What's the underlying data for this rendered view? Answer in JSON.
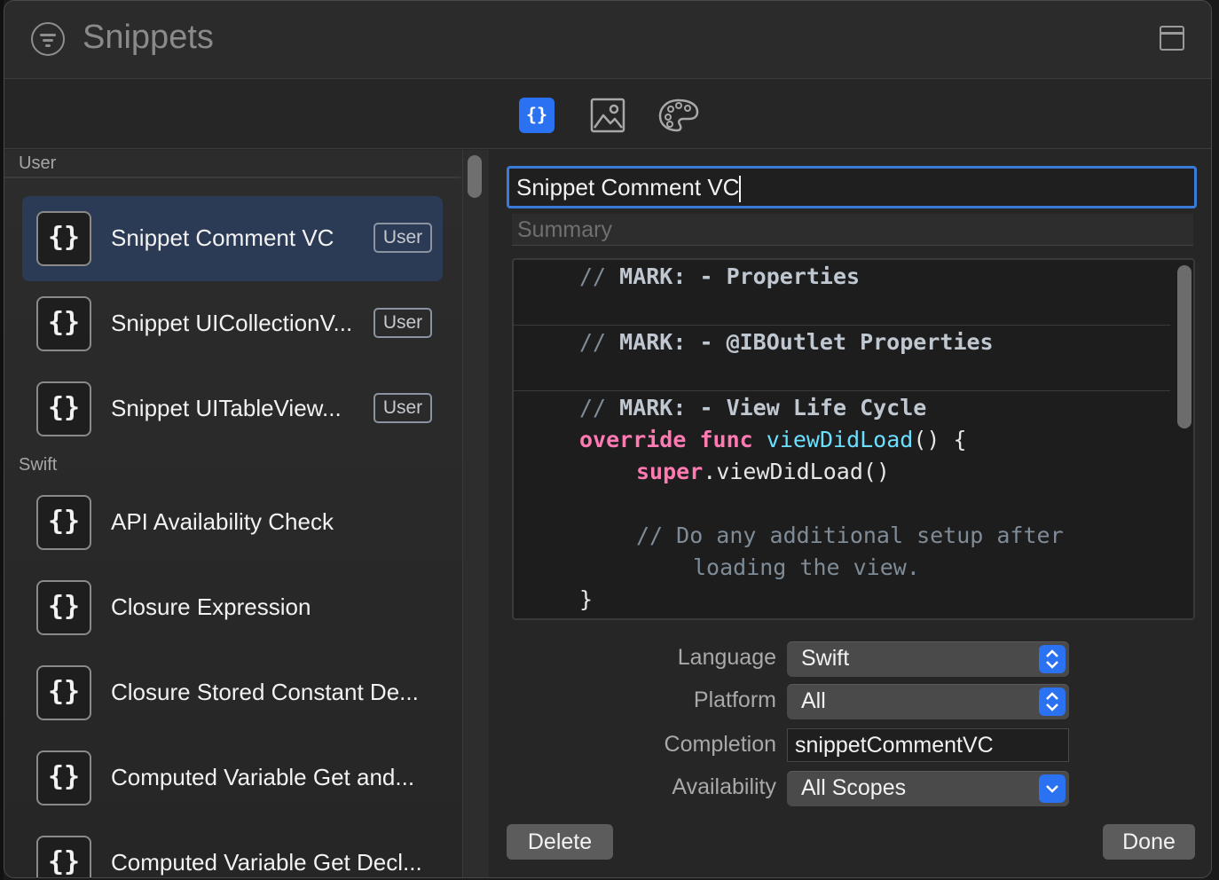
{
  "window": {
    "title": "Snippets"
  },
  "tabs": [
    {
      "name": "code-snippets",
      "icon": "curly-braces-icon",
      "label": "{}",
      "selected": true
    },
    {
      "name": "media",
      "icon": "image-icon",
      "selected": false
    },
    {
      "name": "colors",
      "icon": "palette-icon",
      "selected": false
    }
  ],
  "sidebar": {
    "sections": [
      {
        "header": "User",
        "items": [
          {
            "label": "Snippet Comment VC",
            "badge": "User",
            "selected": true
          },
          {
            "label": "Snippet UICollectionV...",
            "badge": "User"
          },
          {
            "label": "Snippet UITableView...",
            "badge": "User"
          }
        ]
      },
      {
        "header": "Swift",
        "items": [
          {
            "label": "API Availability Check"
          },
          {
            "label": "Closure Expression"
          },
          {
            "label": "Closure Stored Constant De..."
          },
          {
            "label": "Computed Variable Get and..."
          },
          {
            "label": "Computed Variable Get Decl..."
          }
        ]
      }
    ],
    "item_icon": "{}"
  },
  "detail": {
    "name_value": "Snippet Comment VC",
    "summary_placeholder": "Summary",
    "code": {
      "c1": "// ",
      "m1": "MARK: - Properties",
      "c2": "// ",
      "m2": "MARK: - @IBOutlet Properties",
      "c3": "// ",
      "m3": "MARK: - View Life Cycle",
      "k1": "override",
      "k2": "func",
      "f1": "viewDidLoad",
      "p1": "() {",
      "k3": "super",
      "p2": ".viewDidLoad()",
      "cm4a": "// Do any additional setup after",
      "cm4b": "loading the view.",
      "close": "}"
    },
    "properties": {
      "language_label": "Language",
      "language_value": "Swift",
      "platform_label": "Platform",
      "platform_value": "All",
      "completion_label": "Completion",
      "completion_value": "snippetCommentVC",
      "availability_label": "Availability",
      "availability_value": "All Scopes"
    },
    "buttons": {
      "delete": "Delete",
      "done": "Done"
    }
  },
  "colors": {
    "accent": "#2b72f2",
    "selection": "#2c3b55",
    "keyword": "#ff7ab2",
    "function": "#6bdfff",
    "comment": "#7f8c98"
  }
}
